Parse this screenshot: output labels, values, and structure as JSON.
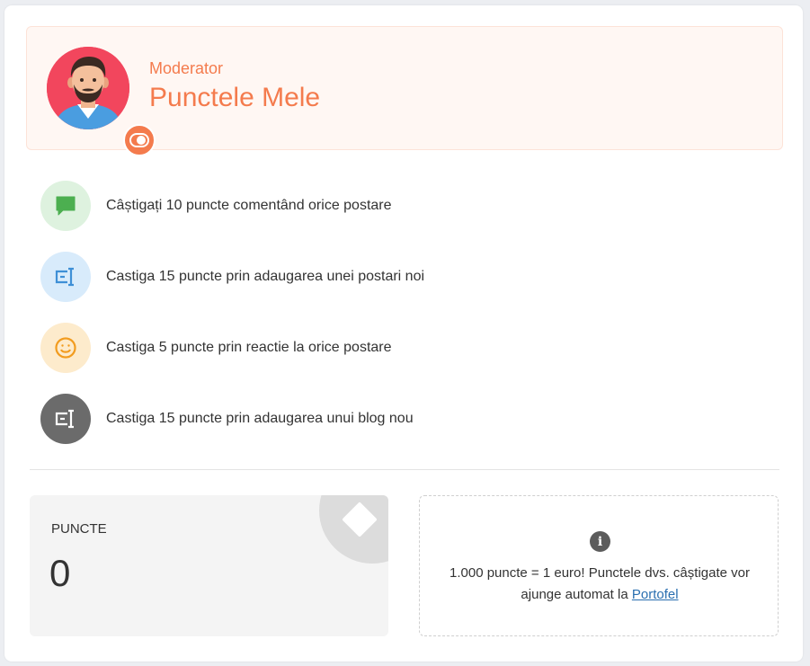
{
  "hero": {
    "role": "Moderator",
    "title": "Punctele Mele",
    "avatar_icon": "user-avatar",
    "badge_icon": "toggle-icon",
    "accent_color": "#f47b4d",
    "avatar_bg_color": "#f2465d"
  },
  "tasks": [
    {
      "icon": "comment-icon",
      "icon_bg": "#def2df",
      "icon_color": "#4caf50",
      "label": "Câștigați 10 puncte comentând orice postare"
    },
    {
      "icon": "post-icon",
      "icon_bg": "#d8ebfb",
      "icon_color": "#3e8fd6",
      "label": "Castiga 15 puncte prin adaugarea unei postari noi"
    },
    {
      "icon": "smile-icon",
      "icon_bg": "#fdebcc",
      "icon_color": "#f29c1f",
      "label": "Castiga 5 puncte prin reactie la orice postare"
    },
    {
      "icon": "blog-icon",
      "icon_bg": "#6b6b6b",
      "icon_color": "#ffffff",
      "label": "Castiga 15 puncte prin adaugarea unui blog nou"
    }
  ],
  "points": {
    "label": "Puncte",
    "value": "0",
    "icon": "diamond-icon"
  },
  "info": {
    "icon": "info-icon",
    "text": "1.000 puncte = 1 euro! Punctele dvs. câștigate vor ajunge automat la",
    "link_label": "Portofel"
  }
}
